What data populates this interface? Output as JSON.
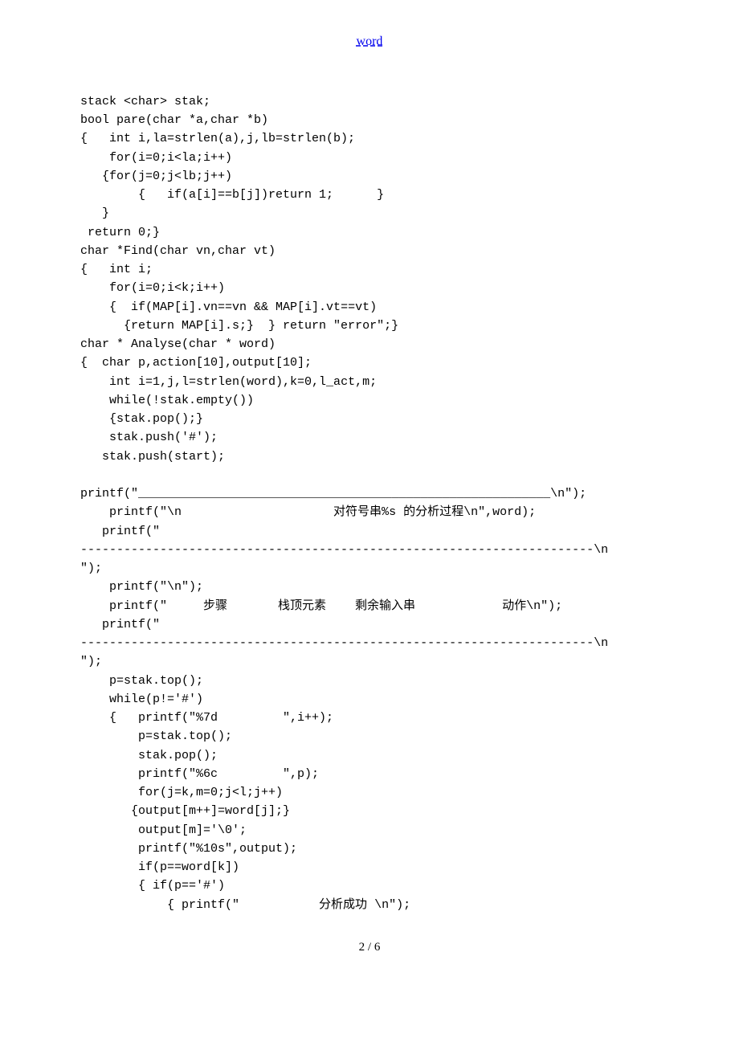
{
  "header": {
    "link_text": "word"
  },
  "code": {
    "line01": "stack <char> stak;",
    "line02": "bool pare(char *a,char *b)",
    "line03": "{   int i,la=strlen(a),j,lb=strlen(b);",
    "line04": "    for(i=0;i<la;i++)",
    "line05": "   {for(j=0;j<lb;j++)",
    "line06": "        {   if(a[i]==b[j])return 1;      }",
    "line07": "   }",
    "line08": " return 0;}",
    "line09": "char *Find(char vn,char vt)",
    "line10": "{   int i;",
    "line11": "    for(i=0;i<k;i++)",
    "line12": "    {  if(MAP[i].vn==vn && MAP[i].vt==vt)",
    "line13": "      {return MAP[i].s;}  } return \"error\";}",
    "line14": "char * Analyse(char * word)",
    "line15": "{  char p,action[10],output[10];",
    "line16": "    int i=1,j,l=strlen(word),k=0,l_act,m;",
    "line17": "    while(!stak.empty())",
    "line18": "    {stak.pop();}",
    "line19": "    stak.push('#');",
    "line20": "   stak.push(start);",
    "line21": "",
    "line22": "printf(\"_________________________________________________________\\n\");",
    "line23": "    printf(\"\\n                     对符号串%s 的分析过程\\n\",word);",
    "line24": "   printf(\"",
    "line25": "-----------------------------------------------------------------------\\n",
    "line26": "\");",
    "line27": "    printf(\"\\n\");",
    "line28": "    printf(\"     步骤       栈顶元素    剩余输入串            动作\\n\");",
    "line29": "   printf(\"",
    "line30": "-----------------------------------------------------------------------\\n",
    "line31": "\");",
    "line32": "    p=stak.top();",
    "line33": "    while(p!='#')",
    "line34": "    {   printf(\"%7d         \",i++);",
    "line35": "        p=stak.top();",
    "line36": "        stak.pop();",
    "line37": "        printf(\"%6c         \",p);",
    "line38": "        for(j=k,m=0;j<l;j++)",
    "line39": "       {output[m++]=word[j];}",
    "line40": "        output[m]='\\0';",
    "line41": "        printf(\"%10s\",output);",
    "line42": "        if(p==word[k])",
    "line43": "        { if(p=='#')",
    "line44": "            { printf(\"           分析成功 \\n\");"
  },
  "footer": {
    "page_number": "2 / 6"
  }
}
